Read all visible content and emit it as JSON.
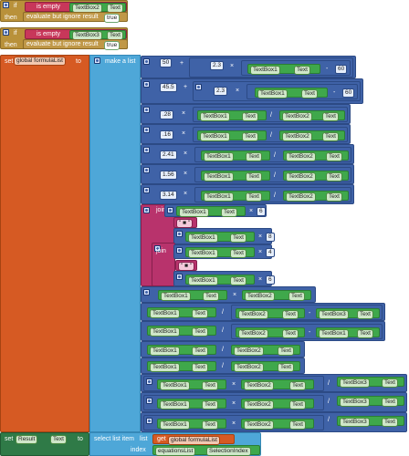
{
  "if_blocks": [
    {
      "if_label": "if",
      "is_empty": "is empty",
      "component": "TextBox2",
      "property": "Text",
      "then": "then",
      "evaluate": "evaluate but ignore result",
      "value": "true"
    },
    {
      "if_label": "if",
      "is_empty": "is empty",
      "component": "TextBox3",
      "property": "Text",
      "then": "then",
      "evaluate": "evaluate but ignore result",
      "value": "true"
    }
  ],
  "set_global": {
    "set": "set",
    "var": "global formulaList",
    "to": "to",
    "make_list": "make a list"
  },
  "ops": {
    "plus": "+",
    "times": "×",
    "minus": "-",
    "div": "/"
  },
  "items": {
    "r1": {
      "n1": "50",
      "n2": "2.3",
      "c": "TextBox1",
      "p": "Text",
      "n3": "60"
    },
    "r2": {
      "n1": "45.5",
      "n2": "2.3",
      "c": "TextBox1",
      "p": "Text",
      "n3": "60"
    },
    "r3": {
      "n": ".28",
      "c1": "TextBox1",
      "p": "Text",
      "c2": "TextBox2"
    },
    "r4": {
      "n": ".16",
      "c1": "TextBox1",
      "p": "Text",
      "c2": "TextBox2"
    },
    "r5": {
      "n": "2.41",
      "c1": "TextBox1",
      "p": "Text",
      "c2": "TextBox2"
    },
    "r6": {
      "n": "1.56",
      "c1": "TextBox1",
      "p": "Text",
      "c2": "TextBox2"
    },
    "r7": {
      "n": "3.14",
      "c1": "TextBox1",
      "p": "Text",
      "c2": "TextBox2"
    },
    "join": {
      "label": "join",
      "quote": "\" ■ \"",
      "n6": "6",
      "n8": "8",
      "n4": "4"
    },
    "t1": "TextBox1",
    "t2": "TextBox2",
    "t3": "TextBox3",
    "text": "Text"
  },
  "set_result": {
    "set": "set",
    "comp": "Result",
    "prop": "Text",
    "to": "to",
    "select": "select list item",
    "list": "list",
    "get": "get",
    "var": "global formulaList",
    "index": "index",
    "idxcomp": "equationsList",
    "idxprop": "SelectionIndex"
  }
}
